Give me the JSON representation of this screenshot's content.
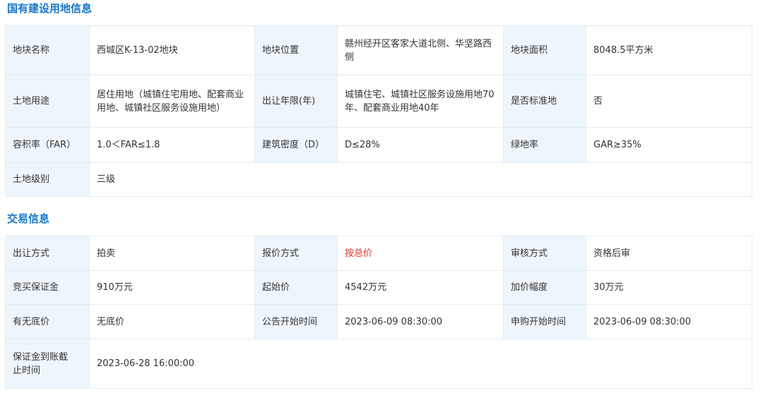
{
  "sections": [
    {
      "title": "国有建设用地信息",
      "rows": [
        [
          {
            "label": "地块名称",
            "value": "西城区K-13-02地块"
          },
          {
            "label": "地块位置",
            "value": "赣州经开区客家大道北侧、华坚路西侧"
          },
          {
            "label": "地块面积",
            "value": "8048.5平方米"
          }
        ],
        [
          {
            "label": "土地用途",
            "value": "居住用地（城镇住宅用地、配套商业用地、城镇社区服务设施用地）"
          },
          {
            "label": "出让年限(年)",
            "value": "城镇住宅、城镇社区服务设施用地70年、配套商业用地40年"
          },
          {
            "label": "是否标准地",
            "value": "否"
          }
        ],
        [
          {
            "label": "容积率（FAR）",
            "value": "1.0＜FAR≤1.8"
          },
          {
            "label": "建筑密度（D）",
            "value": "D≤28%"
          },
          {
            "label": "绿地率",
            "value": "GAR≥35%"
          }
        ],
        [
          {
            "label": "土地级别",
            "value": "三级"
          }
        ]
      ]
    },
    {
      "title": "交易信息",
      "rows": [
        [
          {
            "label": "出让方式",
            "value": "拍卖"
          },
          {
            "label": "报价方式",
            "value": "按总价",
            "highlight": true
          },
          {
            "label": "审核方式",
            "value": "资格后审"
          }
        ],
        [
          {
            "label": "竞买保证金",
            "value": "910万元"
          },
          {
            "label": "起始价",
            "value": "4542万元"
          },
          {
            "label": "加价幅度",
            "value": "30万元"
          }
        ],
        [
          {
            "label": "有无底价",
            "value": "无底价"
          },
          {
            "label": "公告开始时间",
            "value": "2023-06-09 08:30:00"
          },
          {
            "label": "申购开始时间",
            "value": "2023-06-09 08:30:00"
          }
        ],
        [
          {
            "label": "保证金到账截止时间",
            "value": "2023-06-28 16:00:00"
          }
        ]
      ]
    }
  ],
  "colors": {
    "title": "#1677c9",
    "label_bg": "#eef6fd",
    "border": "#e4ebf3",
    "highlight": "#e0312f"
  }
}
